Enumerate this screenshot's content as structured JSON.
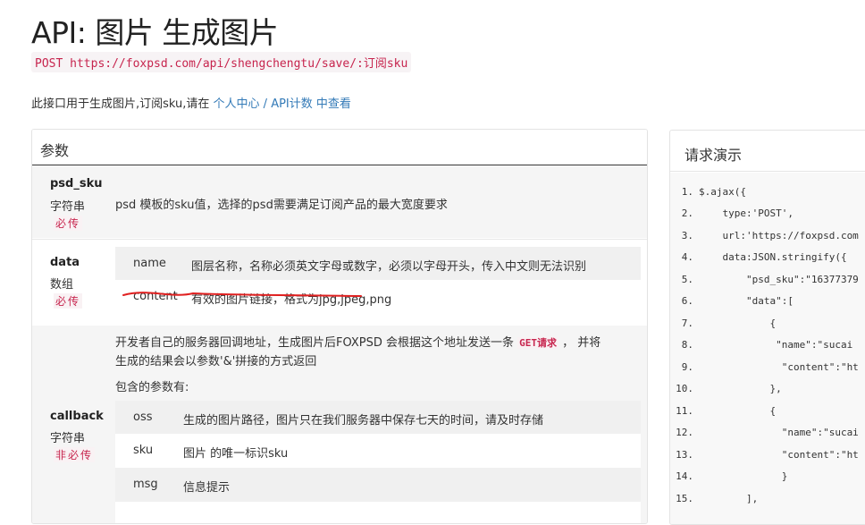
{
  "page": {
    "title": "API: 图片 生成图片",
    "endpoint": "POST https://foxpsd.com/api/shengchengtu/save/:订阅sku",
    "intro_text": "此接口用于生成图片,订阅sku,请在 ",
    "intro_link": "个人中心 / API计数 中查看"
  },
  "params": {
    "heading": "参数",
    "rows": [
      {
        "name": "psd_sku",
        "type": "字符串",
        "required": "必传",
        "desc": "psd 模板的sku值，选择的psd需要满足订阅产品的最大宽度要求"
      },
      {
        "name": "data",
        "type": "数组",
        "required": "必传",
        "sub": [
          {
            "key": "name",
            "value": "图层名称，名称必须英文字母或数字，必须以字母开头，传入中文则无法识别"
          },
          {
            "key": "content",
            "value": "有效的图片链接，格式为jpg,jpeg,png"
          }
        ]
      },
      {
        "name": "callback",
        "type": "字符串",
        "required": "非必传",
        "desc_line1_a": "开发者自己的服务器回调地址，生成图片后FOXPSD 会根据这个地址发送一条 ",
        "desc_code": "GET请求",
        "desc_line1_b": " ， 并将",
        "desc_line2": "生成的结果会以参数'&'拼接的方式返回",
        "desc_line3": "包含的参数有:",
        "sub": [
          {
            "key": "oss",
            "value": "生成的图片路径，图片只在我们服务器中保存七天的时间，请及时存储"
          },
          {
            "key": "sku",
            "value": "图片 的唯一标识sku"
          },
          {
            "key": "msg",
            "value": "信息提示"
          }
        ]
      }
    ]
  },
  "demo": {
    "heading": "请求演示",
    "lines": [
      {
        "n": "1.",
        "text": "$.ajax({"
      },
      {
        "n": "2.",
        "text": "    type:'POST',"
      },
      {
        "n": "3.",
        "text": "    url:'https://foxpsd.com"
      },
      {
        "n": "4.",
        "text": "    data:JSON.stringify({"
      },
      {
        "n": "5.",
        "text": "        \"psd_sku\":\"16377379"
      },
      {
        "n": "6.",
        "text": "        \"data\":["
      },
      {
        "n": "7.",
        "text": "            {"
      },
      {
        "n": "8.",
        "text": "             \"name\":\"sucai"
      },
      {
        "n": "9.",
        "text": "              \"content\":\"ht"
      },
      {
        "n": "10.",
        "text": "            },"
      },
      {
        "n": "11.",
        "text": "            {"
      },
      {
        "n": "12.",
        "text": "              \"name\":\"sucai"
      },
      {
        "n": "13.",
        "text": "              \"content\":\"ht"
      },
      {
        "n": "14.",
        "text": "              }"
      },
      {
        "n": "15.",
        "text": "        ],"
      }
    ]
  },
  "colors": {
    "accent_link": "#337ab7",
    "code_red": "#c7254e",
    "annotation_underline": "#e02020"
  }
}
